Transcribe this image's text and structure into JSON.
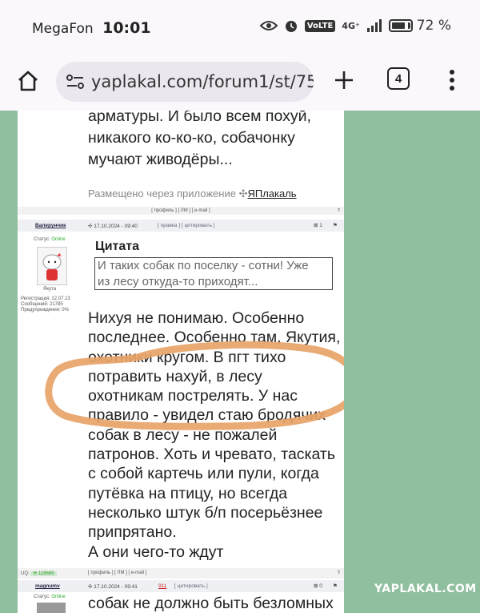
{
  "status_bar": {
    "carrier": "MegaFon",
    "time": "10:01",
    "battery": "72 %",
    "volte": "VoLTE",
    "network": "4G⁺",
    "battery_level": 0.72
  },
  "browser": {
    "url": "yaplakal.com/forum1/st/75",
    "tab_count": "4"
  },
  "prev_post": {
    "lines": [
      "арматуры. И было всем похуй,",
      "никакого ко-ко-ко, собачонку",
      "мучают живодёры..."
    ],
    "via_prefix": "Размещено через приложение ",
    "via_app": "ЯПлакаль",
    "links": "[ профиль ] [ ЛМ ] [ e-mail ]"
  },
  "post": {
    "author": "Валерунчик",
    "date": "17.10.2024 - 09:40",
    "header_links": "[ правка ] [ цитировать ]",
    "status_label": "Статус:",
    "status_value": "Online",
    "rank": "Якута",
    "registered": "Регистрация: 12.07.13",
    "messages": "Сообщений: 21785",
    "warnings": "Предупреждения: 0%",
    "quote_title": "Цитата",
    "quote_lines": [
      "И таких собак по поселку - сотни! Уже",
      "из лесу откуда-то приходят..."
    ],
    "body_lines": [
      "Нихуя не понимаю. Особенно",
      "последнее. Особенно там, Якутия,",
      "охотники кругом. В пгт тихо",
      "потравить нахуй, в лесу",
      "охотникам пострелять. У нас",
      "правило - увидел стаю бродячих",
      "собак в лесу - не пожалей",
      "патронов. Хоть и чревато, таскать",
      "с собой картечь или пули, когда",
      "путёвка на птицу, но всегда",
      "несколько штук б/п посерьёзнее",
      "припрятано.",
      "А они чего-то ждут"
    ],
    "uq_label": "UQ:",
    "uq_value": "118665",
    "footer_links": "[ профиль ] [ ЛМ ] [ e-mail ]"
  },
  "next_post": {
    "author": "magnumv",
    "date": "17.10.2024 - 09:41",
    "num": "911",
    "header_links": "[ цитировать ]",
    "status_label": "Статус:",
    "status_value": "Online",
    "text": "собак не должно быть безломных"
  },
  "watermark": "YAPLAKAL.COM",
  "colors": {
    "highlight": "#e7a368",
    "background": "#8fbf9e"
  }
}
